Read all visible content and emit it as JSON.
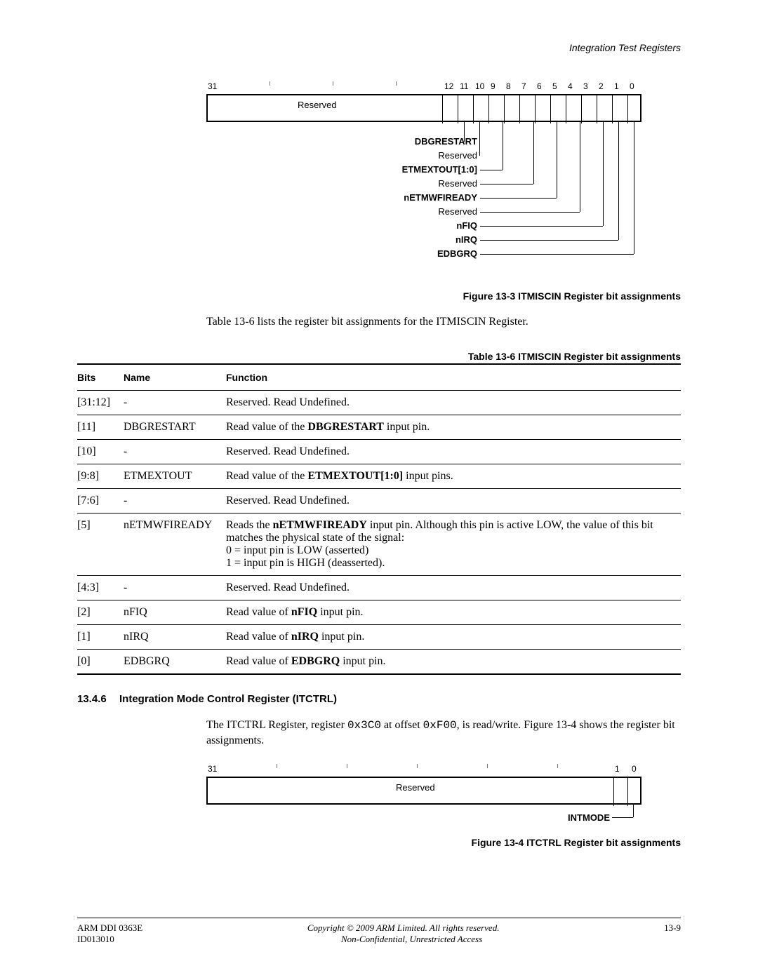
{
  "running_head": "Integration Test Registers",
  "figure1": {
    "caption": "Figure 13-3 ITMISCIN Register bit assignments",
    "reserved_main": "Reserved",
    "bit_labels_left": "31",
    "bit_labels_right": [
      "12",
      "11",
      "10",
      "9",
      "8",
      "7",
      "6",
      "5",
      "4",
      "3",
      "2",
      "1",
      "0"
    ],
    "signals": [
      {
        "name": "DBGRESTART",
        "bold": true
      },
      {
        "name": "Reserved",
        "bold": false
      },
      {
        "name": "ETMEXTOUT[1:0]",
        "bold": true
      },
      {
        "name": "Reserved",
        "bold": false
      },
      {
        "name": "nETMWFIREADY",
        "bold": true
      },
      {
        "name": "Reserved",
        "bold": false
      },
      {
        "name": "nFIQ",
        "bold": true
      },
      {
        "name": "nIRQ",
        "bold": true
      },
      {
        "name": "EDBGRQ",
        "bold": true
      }
    ]
  },
  "intro_text": "Table 13-6 lists the register bit assignments for the ITMISCIN Register.",
  "table_caption": "Table 13-6 ITMISCIN Register bit assignments",
  "table_header": {
    "bits": "Bits",
    "name": "Name",
    "func": "Function"
  },
  "table_rows": [
    {
      "bits": "[31:12]",
      "name": "-",
      "func_html": "Reserved. Read Undefined."
    },
    {
      "bits": "[11]",
      "name": "DBGRESTART",
      "func_html": "Read value of the <b>DBGRESTART</b> input pin."
    },
    {
      "bits": "[10]",
      "name": "-",
      "func_html": "Reserved. Read Undefined."
    },
    {
      "bits": "[9:8]",
      "name": "ETMEXTOUT",
      "func_html": "Read value of the <b>ETMEXTOUT[1:0]</b> input pins."
    },
    {
      "bits": "[7:6]",
      "name": "-",
      "func_html": "Reserved. Read Undefined."
    },
    {
      "bits": "[5]",
      "name": "nETMWFIREADY",
      "func_html": "Reads the <b>nETMWFIREADY</b> input pin. Although this pin is active LOW, the value of this bit matches the physical state of the signal:<br>0 = input pin is LOW (asserted)<br>1 = input pin is HIGH (deasserted)."
    },
    {
      "bits": "[4:3]",
      "name": "-",
      "func_html": "Reserved. Read Undefined."
    },
    {
      "bits": "[2]",
      "name": "nFIQ",
      "func_html": "Read value of <b>nFIQ</b> input pin."
    },
    {
      "bits": "[1]",
      "name": "nIRQ",
      "func_html": "Read value of <b>nIRQ</b> input pin."
    },
    {
      "bits": "[0]",
      "name": "EDBGRQ",
      "func_html": "Read value of <b>EDBGRQ</b> input pin."
    }
  ],
  "section": {
    "num": "13.4.6",
    "title": "Integration Mode Control Register (ITCTRL)",
    "body_pre": "The ITCTRL Register, register ",
    "reg_code": "0x3C0",
    "body_mid": " at offset ",
    "off_code": "0xF00",
    "body_post": ", is read/write. Figure 13-4 shows the register bit assignments."
  },
  "figure2": {
    "caption": "Figure 13-4 ITCTRL Register bit assignments",
    "bit_left": "31",
    "bit_r1": "1",
    "bit_r0": "0",
    "reserved": "Reserved",
    "signal": "INTMODE"
  },
  "footer": {
    "left1": "ARM DDI 0363E",
    "left2": "ID013010",
    "center1": "Copyright © 2009 ARM Limited. All rights reserved.",
    "center2": "Non-Confidential, Unrestricted Access",
    "right": "13-9"
  }
}
